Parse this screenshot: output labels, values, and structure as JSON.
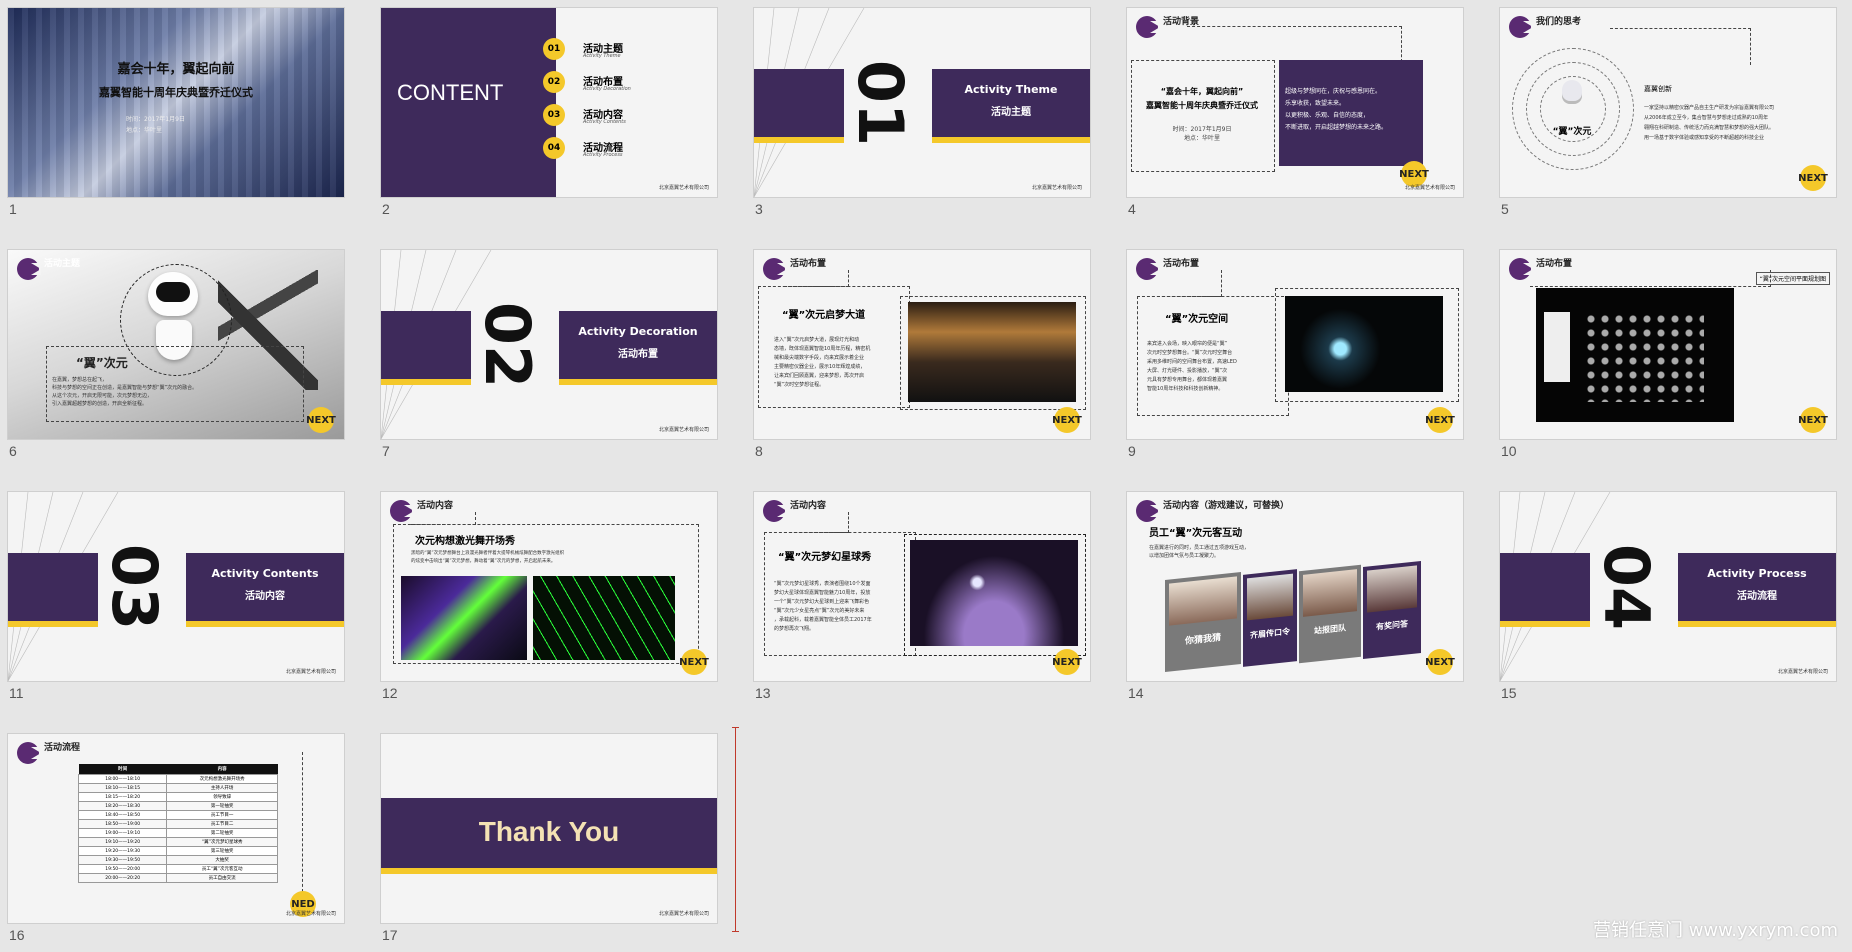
{
  "slides": [
    {
      "num": "1",
      "title1": "嘉会十年，翼起向前",
      "title2": "嘉翼智能十周年庆典暨乔迁仪式",
      "meta1": "时间：2017年1月9日",
      "meta2": "地点：华叶里"
    },
    {
      "num": "2",
      "title": "CONTENT",
      "items": [
        {
          "n": "01",
          "zh": "活动主题",
          "en": "Activity Theme"
        },
        {
          "n": "02",
          "zh": "活动布置",
          "en": "Activity Decoration"
        },
        {
          "n": "03",
          "zh": "活动内容",
          "en": "Activity Contents"
        },
        {
          "n": "04",
          "zh": "活动流程",
          "en": "Activity Process"
        }
      ],
      "company": "北京嘉翼艺术有限公司"
    },
    {
      "num": "3",
      "big": "01",
      "en": "Activity Theme",
      "zh": "活动主题",
      "company": "北京嘉翼艺术有限公司"
    },
    {
      "num": "4",
      "tag": "活动背景",
      "t1": "“嘉会十年，翼起向前”",
      "t2": "嘉翼智能十周年庆典暨乔迁仪式",
      "m1": "时间：2017年1月9日",
      "m2": "地点：华叶里",
      "r1": "超级与梦想同在，庆祝与感恩同在。",
      "r2": "乐享收获，致望未来。",
      "r3": "以更积极、乐观、自信的态度，",
      "r4": "不断进取，开启超越梦想的未来之路。",
      "next": "NEXT",
      "company": "北京嘉翼艺术有限公司"
    },
    {
      "num": "5",
      "tag": "我们的思考",
      "label": "“翼”次元",
      "h": "嘉翼创新",
      "b1": "一家坚持以精密仪器产品自主生产研发为宗旨嘉翼有限公司",
      "b2": "从2006年成立至今，集合智慧与梦想走过成熟的10周年",
      "b3": "翱翔在科研制造、传统活力而充满智慧和梦想的强大团队。",
      "b4": "用一场基于数字体验或感知享受的不断超越的科技企业",
      "next": "NEXT"
    },
    {
      "num": "6",
      "tag": "活动主题",
      "label": "“翼”次元",
      "s1": "在嘉翼，梦想总在起飞，",
      "s2": "科技与梦想的空间正在创造，是嘉翼智能与梦想“翼”次元的融合。",
      "s3": "从这个次元，开启无限可能，次元梦想无边，",
      "s4": "引入嘉翼超越梦想的创造，开启全新征程。",
      "next": "NEXT"
    },
    {
      "num": "7",
      "big": "02",
      "en": "Activity Decoration",
      "zh": "活动布置",
      "company": "北京嘉翼艺术有限公司"
    },
    {
      "num": "8",
      "tag": "活动布置",
      "h": "“翼”次元启梦大道",
      "b1": "进入“翼”次元启梦大道，展现灯光和动",
      "b2": "态墙，既体现嘉翼智能10周年历程，精密机",
      "b3": "械和最尖端数字手段，向来宾展示着企业",
      "b4": "主要精密仪器企业，展示10年辉煌成绩，",
      "b5": "让来宾们回顾嘉翼，迎来梦想，再次开启",
      "b6": "“翼”次时空梦想征程。",
      "next": "NEXT"
    },
    {
      "num": "9",
      "tag": "活动布置",
      "h": "“翼”次元空间",
      "b1": "来宾进入会场，映入眼帘的便是“翼”",
      "b2": "次元时空梦想舞台。“翼”次元时空舞台",
      "b3": "采用多维时间的空间舞台布置，高速LED",
      "b4": "大屏、灯光硬件、投影播放，“翼”次",
      "b5": "元具有梦想专用舞台，都体现着嘉翼",
      "b6": "智能10周年科技和科技创新精神。",
      "next": "NEXT"
    },
    {
      "num": "10",
      "tag": "活动布置",
      "label": "“翼”次元空间平面规划图",
      "next": "NEXT"
    },
    {
      "num": "11",
      "big": "03",
      "en": "Activity Contents",
      "zh": "活动内容",
      "company": "北京嘉翼艺术有限公司"
    },
    {
      "num": "12",
      "tag": "活动内容",
      "h": "次元构想激光舞开场秀",
      "b1": "黑暗的“翼”次元梦想舞台上浪漫光舞者伴着大提琴机械炫舞配合数字激光组织",
      "b2": "的炫变中击响出“翼”次元梦想，舞动着“翼”次元的梦想，开启起航未来。",
      "next": "NEXT"
    },
    {
      "num": "13",
      "tag": "活动内容",
      "h": "“翼”次元梦幻星球秀",
      "b1": "“翼”次元梦幻星球秀，表演者围绕10个发面",
      "b2": "梦幻大星球体现嘉翼智能魅力10周年，投放",
      "b3": "一个“翼”次元梦幻大星球到上迎来飞舞彩色",
      "b4": "“翼”次元少女星亮点“翼”次元的美好未来",
      "b5": "，承载起科，载着嘉翼智能全体员工2017年",
      "b6": "的梦想再次飞翔。",
      "next": "NEXT"
    },
    {
      "num": "14",
      "tag": "活动内容（游戏建议，可替换）",
      "h": "员工“翼”次元客互动",
      "b1": "在嘉翼进行的同时，员工通过五项游戏互动，",
      "b2": "以增加团体气氛与员工凝聚力。",
      "cards": [
        "你猜我猜",
        "齐眉传口令",
        "站报团队",
        "有奖问答"
      ],
      "next": "NEXT"
    },
    {
      "num": "15",
      "big": "04",
      "en": "Activity Process",
      "zh": "活动流程",
      "company": "北京嘉翼艺术有限公司"
    },
    {
      "num": "16",
      "tag": "活动流程",
      "th": [
        "时间",
        "内容"
      ],
      "rows": [
        [
          "18:00——18:10",
          "次元构想激光舞开场秀"
        ],
        [
          "18:10——18:15",
          "主持人开场"
        ],
        [
          "18:15——18:20",
          "领导致辞"
        ],
        [
          "18:20——18:30",
          "第一轮抽奖"
        ],
        [
          "18:40——18:50",
          "员工节目一"
        ],
        [
          "18:50——19:00",
          "员工节目二"
        ],
        [
          "19:00——19:10",
          "第二轮抽奖"
        ],
        [
          "19:10——19:20",
          "“翼”次元梦幻星球秀"
        ],
        [
          "19:20——19:30",
          "第三轮抽奖"
        ],
        [
          "19:30——19:50",
          "大抽奖"
        ],
        [
          "19:50——20:00",
          "员工“翼”次元客互动"
        ],
        [
          "20:00——20:20",
          "员工自由交流"
        ]
      ],
      "next": "NED",
      "company": "北京嘉翼艺术有限公司"
    },
    {
      "num": "17",
      "thanks": "Thank You",
      "company": "北京嘉翼艺术有限公司"
    }
  ],
  "watermark": "营销任意门 www.yxrym.com"
}
